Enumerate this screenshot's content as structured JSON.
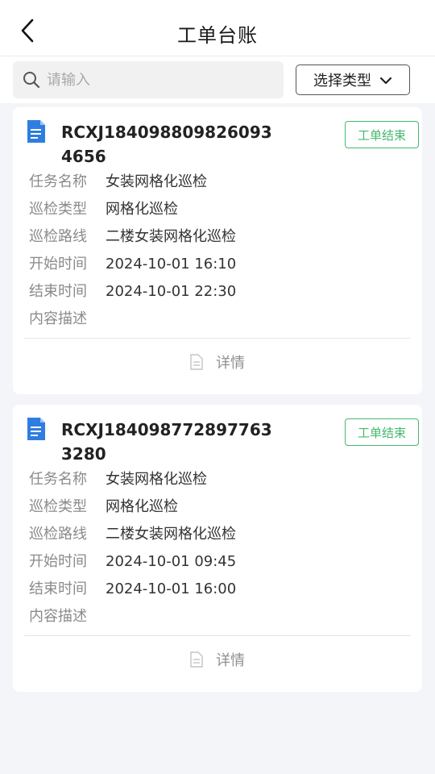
{
  "header": {
    "title": "工单台账"
  },
  "search": {
    "placeholder": "请输入",
    "value": ""
  },
  "filter": {
    "type_label": "选择类型"
  },
  "colors": {
    "accent_green": "#45b86e",
    "doc_blue": "#2f7de0"
  },
  "labels": {
    "task_name": "任务名称",
    "inspection_type": "巡检类型",
    "inspection_route": "巡检路线",
    "start_time": "开始时间",
    "end_time": "结束时间",
    "description": "内容描述",
    "detail": "详情"
  },
  "orders": [
    {
      "code": "RCXJ1840988098260934656",
      "status": "工单结束",
      "task_name": "女装网格化巡检",
      "inspection_type": "网格化巡检",
      "inspection_route": "二楼女装网格化巡检",
      "start_time": "2024-10-01 16:10",
      "end_time": "2024-10-01 22:30",
      "description": ""
    },
    {
      "code": "RCXJ1840987728977633280",
      "status": "工单结束",
      "task_name": "女装网格化巡检",
      "inspection_type": "网格化巡检",
      "inspection_route": "二楼女装网格化巡检",
      "start_time": "2024-10-01 09:45",
      "end_time": "2024-10-01 16:00",
      "description": ""
    }
  ]
}
